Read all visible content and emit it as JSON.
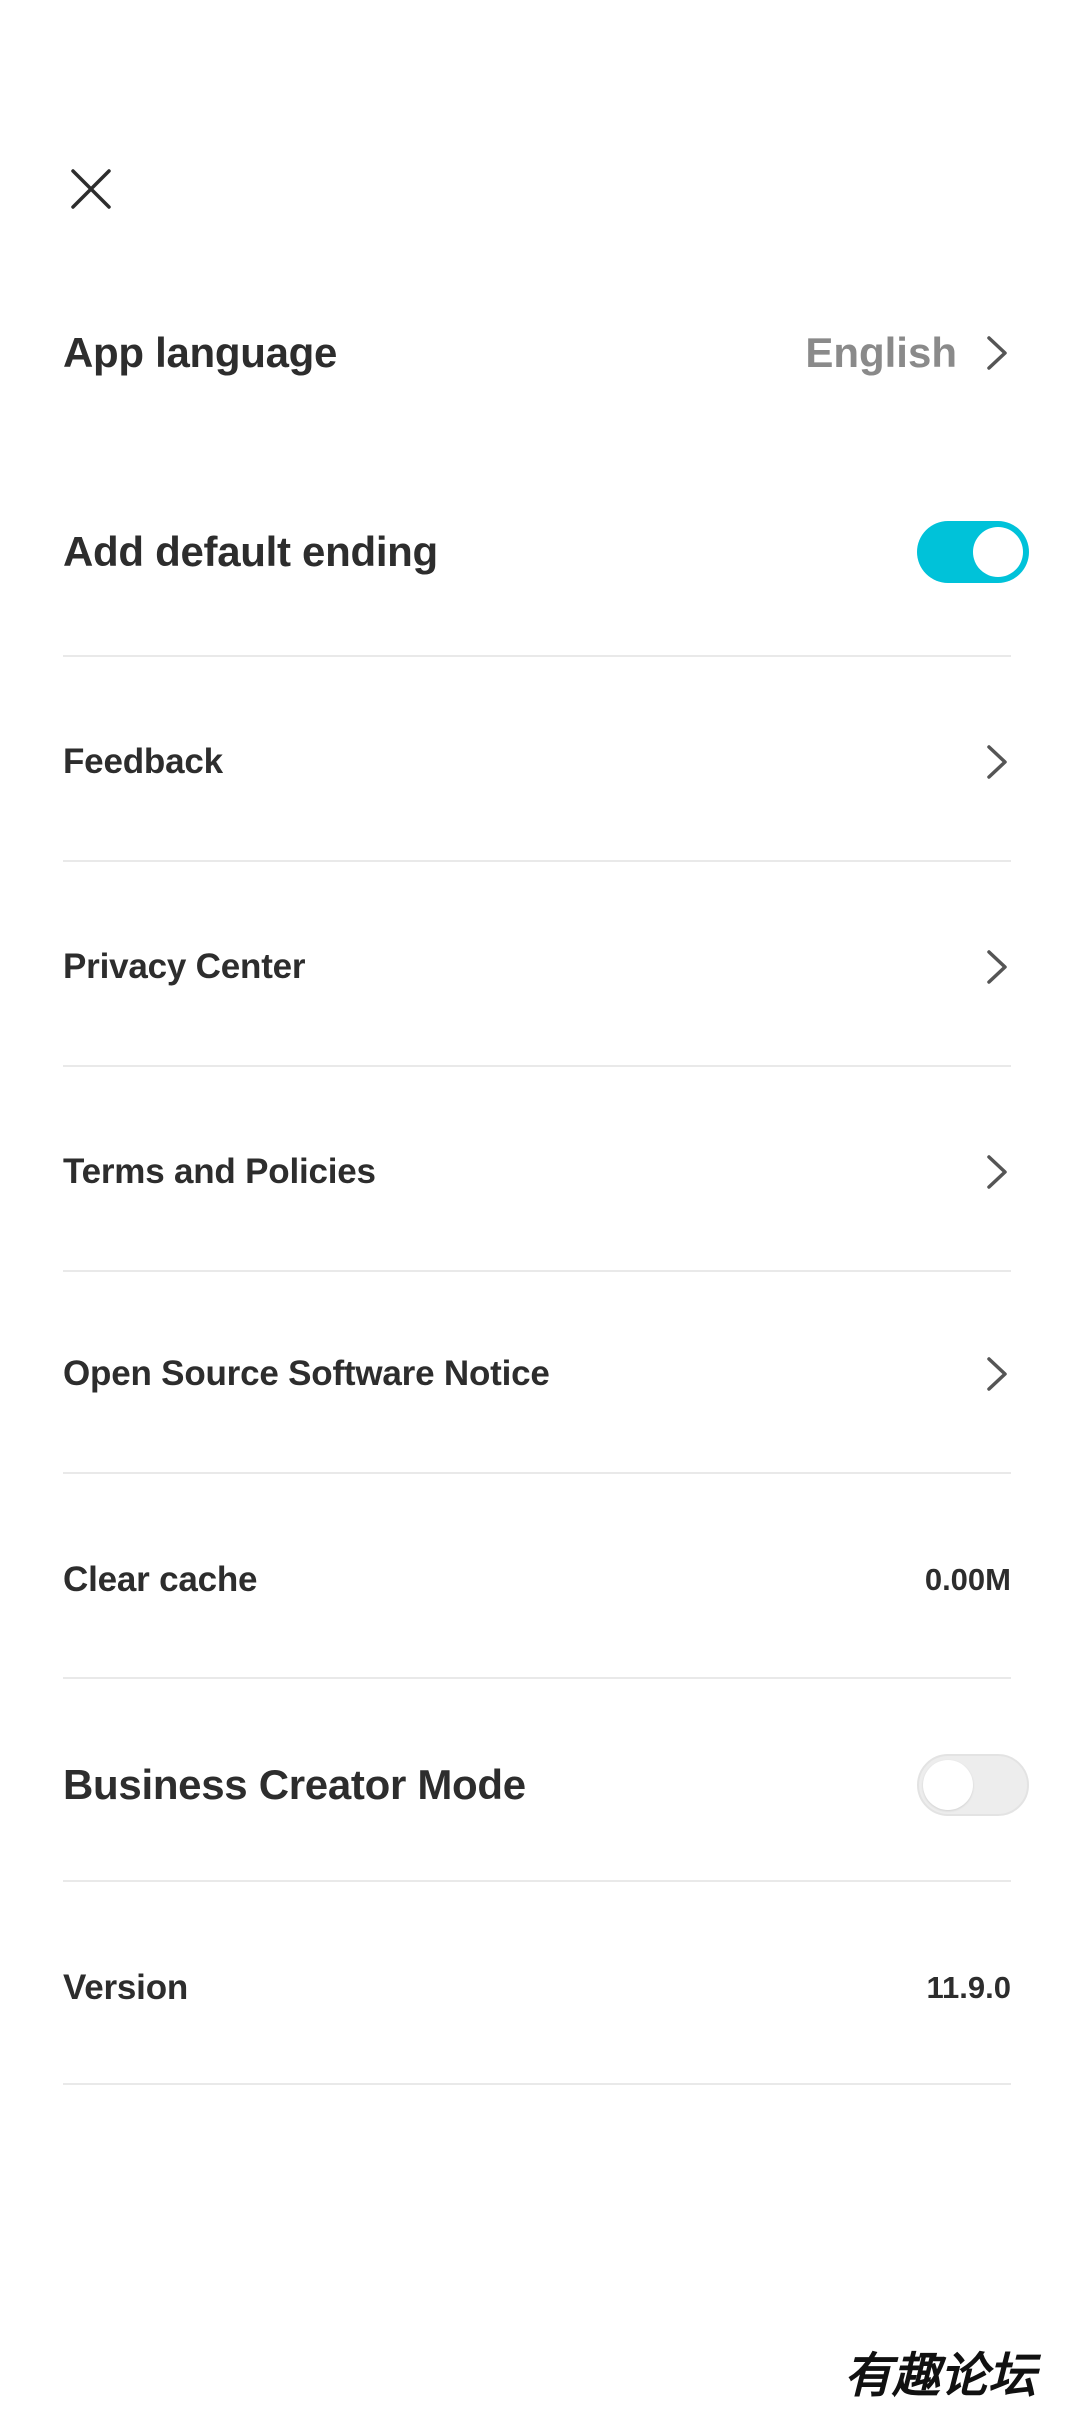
{
  "header": {
    "close_icon": "close-icon"
  },
  "settings": {
    "app_language": {
      "label": "App language",
      "value": "English"
    },
    "add_default_ending": {
      "label": "Add default ending",
      "enabled": true
    },
    "feedback": {
      "label": "Feedback"
    },
    "privacy_center": {
      "label": "Privacy Center"
    },
    "terms_and_policies": {
      "label": "Terms and Policies"
    },
    "open_source_notice": {
      "label": "Open Source Software Notice"
    },
    "clear_cache": {
      "label": "Clear cache",
      "value": "0.00M"
    },
    "business_creator_mode": {
      "label": "Business Creator Mode",
      "enabled": false
    },
    "version": {
      "label": "Version",
      "value": "11.9.0"
    }
  },
  "watermark": {
    "text": "有趣论坛"
  },
  "colors": {
    "accent": "#00c2d9",
    "text": "#2d2d2d",
    "muted": "#8a8a8a",
    "divider": "#e9e9e9"
  }
}
